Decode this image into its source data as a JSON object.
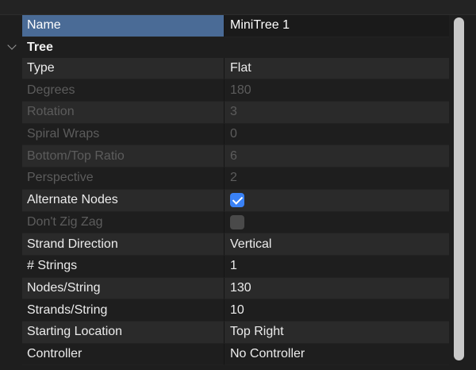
{
  "grid": {
    "name_row": {
      "name": "Name",
      "value": "MiniTree 1"
    },
    "category": {
      "label": "Tree"
    },
    "rows": [
      {
        "name": "Type",
        "value": "Flat",
        "disabled": false
      },
      {
        "name": "Degrees",
        "value": "180",
        "disabled": true
      },
      {
        "name": "Rotation",
        "value": "3",
        "disabled": true
      },
      {
        "name": "Spiral Wraps",
        "value": "0",
        "disabled": true
      },
      {
        "name": "Bottom/Top Ratio",
        "value": "6",
        "disabled": true
      },
      {
        "name": "Perspective",
        "value": "2",
        "disabled": true
      },
      {
        "name": "Alternate Nodes",
        "checkbox": true,
        "checked": true,
        "disabled": false
      },
      {
        "name": "Don't Zig Zag",
        "checkbox": true,
        "checked": false,
        "disabled": true
      },
      {
        "name": "Strand Direction",
        "value": "Vertical",
        "disabled": false
      },
      {
        "name": "# Strings",
        "value": "1",
        "disabled": false
      },
      {
        "name": "Nodes/String",
        "value": "130",
        "disabled": false
      },
      {
        "name": "Strands/String",
        "value": "10",
        "disabled": false
      },
      {
        "name": "Starting Location",
        "value": "Top Right",
        "disabled": false
      },
      {
        "name": "Controller",
        "value": "No Controller",
        "disabled": false
      }
    ]
  },
  "colors": {
    "selection": "#4a6b96",
    "checkbox_checked": "#3a82f7",
    "disabled_text": "#5c5c5c"
  },
  "icons": {
    "collapse": "chevron-down-icon",
    "check": "checkmark-icon"
  }
}
